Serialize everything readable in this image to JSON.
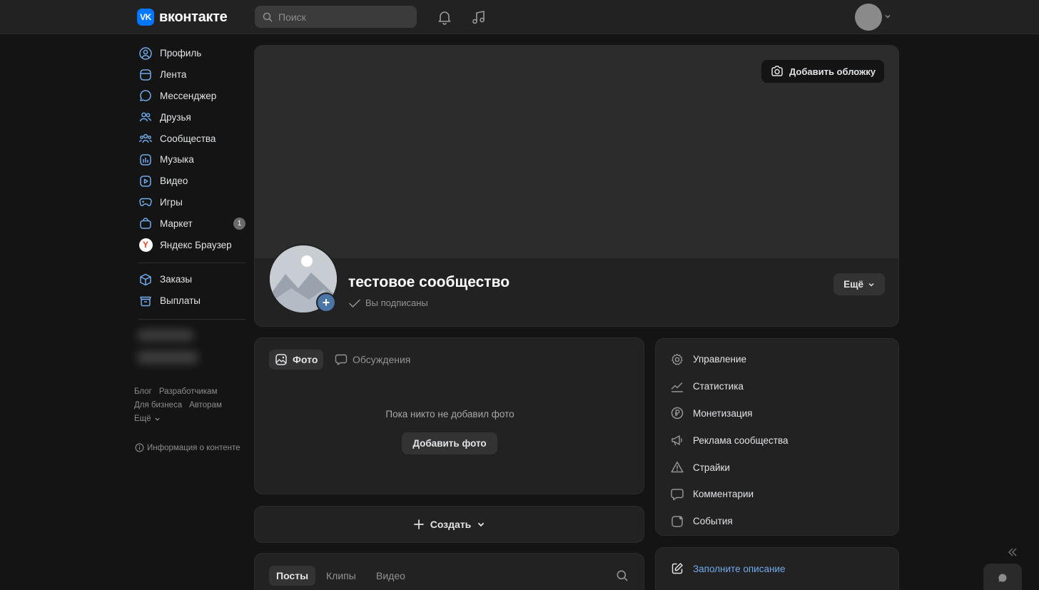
{
  "header": {
    "logo_text": "вконтакте",
    "logo_mark": "VK",
    "search_placeholder": "Поиск"
  },
  "nav": {
    "items": [
      {
        "label": "Профиль",
        "icon": "profile-icon"
      },
      {
        "label": "Лента",
        "icon": "feed-icon"
      },
      {
        "label": "Мессенджер",
        "icon": "messenger-icon"
      },
      {
        "label": "Друзья",
        "icon": "friends-icon"
      },
      {
        "label": "Сообщества",
        "icon": "communities-icon"
      },
      {
        "label": "Музыка",
        "icon": "music-icon"
      },
      {
        "label": "Видео",
        "icon": "video-icon"
      },
      {
        "label": "Игры",
        "icon": "games-icon"
      },
      {
        "label": "Маркет",
        "icon": "market-icon",
        "badge": "1"
      },
      {
        "label": "Яндекс Браузер",
        "icon": "yandex-browser-icon"
      }
    ],
    "secondary_items": [
      {
        "label": "Заказы",
        "icon": "orders-icon"
      },
      {
        "label": "Выплаты",
        "icon": "payouts-icon"
      }
    ],
    "footer_links": {
      "blog": "Блог",
      "developers": "Разработчикам",
      "business": "Для бизнеса",
      "authors": "Авторам",
      "more": "Ещё"
    },
    "info_link": "Информация о контенте"
  },
  "community": {
    "add_cover_label": "Добавить обложку",
    "name": "тестовое сообщество",
    "subscribed_label": "Вы подписаны",
    "more_label": "Ещё"
  },
  "photos": {
    "tabs": [
      {
        "label": "Фото",
        "active": true
      },
      {
        "label": "Обсуждения",
        "active": false
      }
    ],
    "empty_text": "Пока никто не добавил фото",
    "add_photo_label": "Добавить фото"
  },
  "create": {
    "label": "Создать"
  },
  "posts": {
    "tabs": [
      {
        "label": "Посты",
        "active": true
      },
      {
        "label": "Клипы",
        "active": false
      },
      {
        "label": "Видео",
        "active": false
      }
    ]
  },
  "management": {
    "items": [
      {
        "label": "Управление",
        "icon": "gear-icon"
      },
      {
        "label": "Статистика",
        "icon": "stats-icon"
      },
      {
        "label": "Монетизация",
        "icon": "ruble-icon"
      },
      {
        "label": "Реклама сообщества",
        "icon": "megaphone-icon"
      },
      {
        "label": "Страйки",
        "icon": "warning-icon"
      },
      {
        "label": "Комментарии",
        "icon": "comment-icon"
      },
      {
        "label": "События",
        "icon": "events-icon"
      }
    ]
  },
  "description": {
    "fill_label": "Заполните описание"
  },
  "colors": {
    "background": "#141414",
    "card": "#222222",
    "accent": "#0077ff",
    "link": "#71aaeb"
  }
}
